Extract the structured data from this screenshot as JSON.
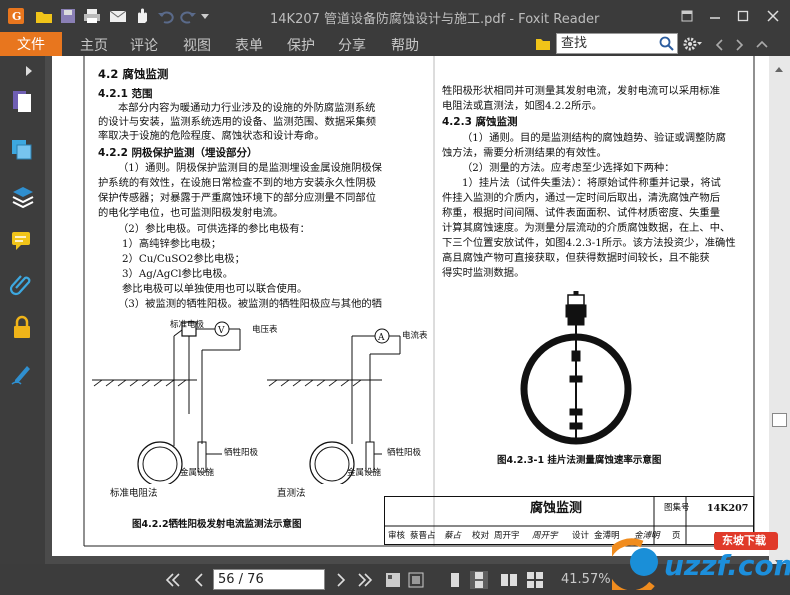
{
  "window": {
    "title": "14K207 管道设备防腐蚀设计与施工.pdf - Foxit Reader"
  },
  "quick_access": [
    "app-icon",
    "open-icon",
    "save-icon",
    "print-icon",
    "email-icon",
    "hand-tool-icon",
    "undo-icon",
    "redo-icon",
    "customize-icon"
  ],
  "ribbon": {
    "file_tab": "文件",
    "tabs": [
      "主页",
      "评论",
      "视图",
      "表单",
      "保护",
      "分享",
      "帮助"
    ],
    "search_placeholder": "查找"
  },
  "status_bar": {
    "page_indicator": "56 / 76",
    "zoom": "41.57%"
  },
  "watermark": {
    "text": "uzzf.com",
    "tag": "东坡下载"
  },
  "document": {
    "left_column": {
      "section_title": "4.2 腐蚀监测",
      "s421_heading": "4.2.1 范围",
      "s421_lines": [
        "本部分内容为暖通动力行业涉及的设施的外防腐监测系统",
        "的设计与安装，监测系统选用的设备、监测范围、数据采集频",
        "率取决于设施的危险程度、腐蚀状态和设计寿命。"
      ],
      "s422_heading": "4.2.2 阴极保护监测（埋设部分）",
      "s422_lines": [
        "（1）通则。阴极保护监测目的是监测埋设金属设施阴极保",
        "护系统的有效性，在设施日常检查不到的地方安装永久性阴极",
        "保护传感器；对暴露于严重腐蚀环境下的部分应测量不同部位",
        "的电化学电位，也可监测阳极发射电流。",
        "（2）参比电极。可供选择的参比电极有：",
        "1）高纯锌参比电极；",
        "2）Cu/CuSO2参比电极；",
        "3）Ag/AgCl参比电极。",
        "参比电极可以单独使用也可以联合使用。",
        "（3）被监测的牺牲阳极。被监测的牺牲阳极应与其他的牺"
      ],
      "figure_labels": {
        "ref_electrode": "标准电极",
        "voltmeter": "电压表",
        "ammeter": "电流表",
        "anode_left": "牺牲阳极",
        "anode_right": "牺牲阳极",
        "metal_left": "金属设施",
        "metal_right": "金属设施",
        "method_left": "标准电阻法",
        "method_right": "直测法"
      },
      "figure_caption": "图4.2.2牺牲阳极发射电流监测法示意图"
    },
    "right_column": {
      "top_lines": [
        "牲阳极形状相同并可测量其发射电流，发射电流可以采用标准",
        "电阻法或直测法，如图4.2.2所示。"
      ],
      "s423_heading": "4.2.3 腐蚀监测",
      "s423_lines": [
        "（1）通则。目的是监测结构的腐蚀趋势、验证或调整防腐",
        "蚀方法，需要分析测结果的有效性。",
        "（2）测量的方法。应考虑至少选择如下两种：",
        "1）挂片法（试件失重法）：将原始试件称重并记录，将试",
        "件挂入监测的介质内，通过一定时间后取出，清洗腐蚀产物后",
        "称重，根据时间间隔、试件表面面积、试件材质密度、失重量",
        "计算其腐蚀速度。为测量分层流动的介质腐蚀数据，在上、中、",
        "下三个位置安放试件，如图4.2.3-1所示。该方法投资少，准确性",
        "高且腐蚀产物可直接获取，但获得数据时间较长，且不能获",
        "得实时监测数据。"
      ],
      "figure_caption": "图4.2.3-1 挂片法测量腐蚀速率示意图"
    },
    "title_block": {
      "title": "腐蚀监测",
      "atlas_label": "图集号",
      "atlas_no": "14K207",
      "page_label": "页",
      "page_no": "52",
      "signature_row": [
        "审核",
        "蔡晋占",
        "蔡占",
        "校对",
        "周开宇",
        "周开宇",
        "设计",
        "金溥明",
        "金溥明"
      ]
    }
  },
  "colors": {
    "accent": "#e8761e",
    "titlebar": "#3b3b3b",
    "doc_bg": "#4b4b4b"
  }
}
